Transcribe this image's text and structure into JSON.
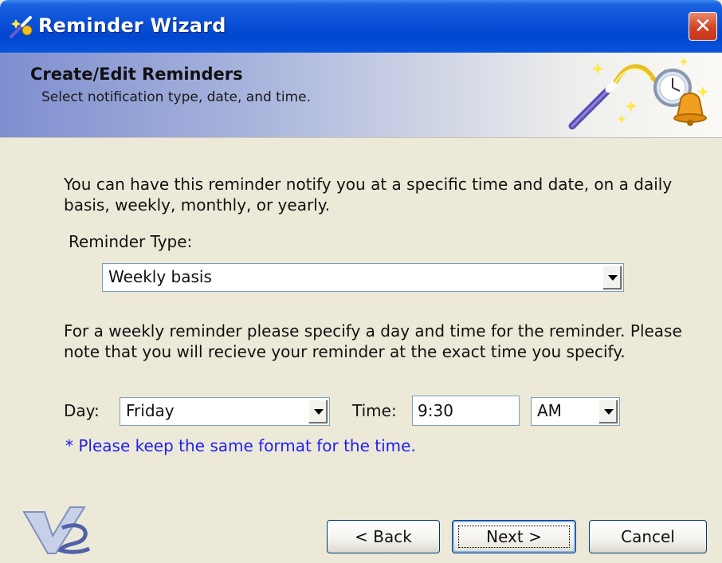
{
  "window": {
    "title": "Reminder Wizard",
    "close_label": "✕",
    "app_icon": "wizard-icon"
  },
  "header": {
    "title": "Create/Edit Reminders",
    "subtitle": "Select notification type, date, and time.",
    "image": "magic-wand-bell-icon"
  },
  "body": {
    "intro_text": "You can have this reminder notify you at a specific time and date, on a daily basis, weekly, monthly, or yearly.",
    "reminder_type_label": "Reminder Type:",
    "reminder_type_value": "Weekly basis",
    "weekly_text": "For a weekly reminder please specify a day and time for the reminder.  Please note that you will recieve your reminder at the exact time you specify.",
    "day_label": "Day:",
    "day_value": "Friday",
    "time_label": "Time:",
    "time_value": "9:30",
    "ampm_value": "AM",
    "format_note": "* Please keep the same format for the time."
  },
  "footer": {
    "logo": "vs-logo",
    "back_label": "< Back",
    "next_label": "Next >",
    "cancel_label": "Cancel"
  },
  "colors": {
    "titlebar": "#0a4fd6",
    "dialog_bg": "#ece9d8",
    "note_text": "#2020f0",
    "close_button": "#d44323"
  }
}
